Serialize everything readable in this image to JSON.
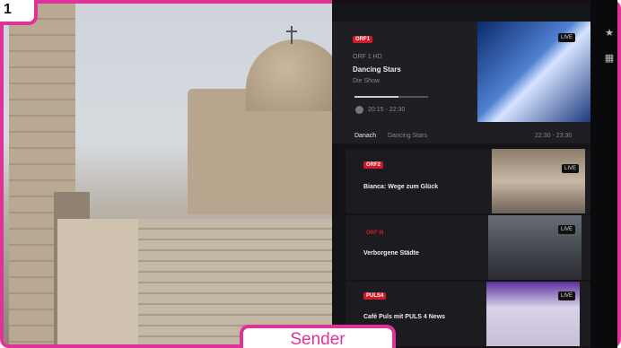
{
  "corner_label": "1",
  "sender_label": "Sender",
  "live": {
    "channel_logo": "ORF1",
    "channel_name": "ORF 1 HD",
    "title": "Dancing Stars",
    "subtitle": "Die Show",
    "time_range": "20:15 - 22:30",
    "thumb_badge": "LIVE",
    "next_label": "Danach",
    "next_title": "Dancing Stars",
    "next_time": "22:30 - 23:30",
    "progress": 0.6
  },
  "channels": [
    {
      "logo": "ORF2",
      "title": "Bianca: Wege zum Glück",
      "badge": "LIVE"
    },
    {
      "logo": "ORF III",
      "title": "Verborgene Städte",
      "badge": "LIVE"
    },
    {
      "logo": "PULS4",
      "title": "Café Puls mit PULS 4 News",
      "badge": "LIVE"
    }
  ],
  "rail_icons": [
    "star-icon",
    "grid-icon"
  ],
  "colors": {
    "annotation": "#e0339a",
    "panel": "#0c0c10",
    "brand_red": "#d31b27"
  }
}
